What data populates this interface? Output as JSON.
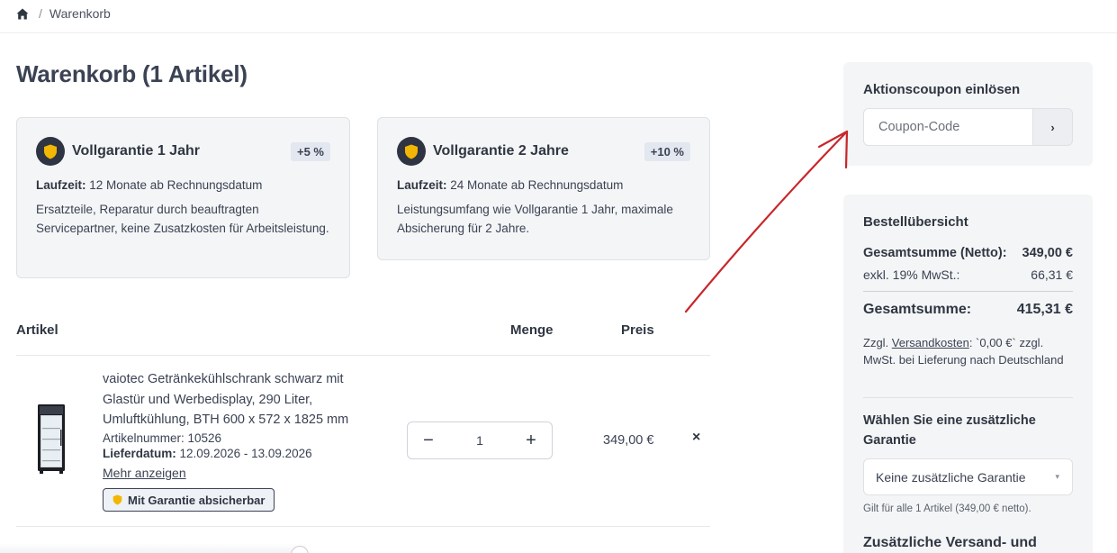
{
  "breadcrumb": {
    "home_icon": "home-icon",
    "separator": "/",
    "current": "Warenkorb"
  },
  "page": {
    "title": "Warenkorb (1 Artikel)"
  },
  "warranty_cards": [
    {
      "title": "Vollgarantie 1 Jahr",
      "badge": "+5 %",
      "runtime_label": "Laufzeit:",
      "runtime_value": "12 Monate ab Rechnungsdatum",
      "description": "Ersatzteile, Reparatur durch beauftragten Servicepartner, keine Zusatzkosten für Arbeitsleistung."
    },
    {
      "title": "Vollgarantie 2 Jahre",
      "badge": "+10 %",
      "runtime_label": "Laufzeit:",
      "runtime_value": "24 Monate ab Rechnungsdatum",
      "description": "Leistungsumfang wie Vollgarantie 1 Jahr, maximale Absicherung für 2 Jahre."
    }
  ],
  "table": {
    "col_article": "Artikel",
    "col_quantity": "Menge",
    "col_price": "Preis"
  },
  "cart_item": {
    "name": "vaiotec Getränkekühlschrank schwarz mit Glastür und Werbedisplay, 290 Liter, Umluftkühlung, BTH 600 x 572 x 1825 mm",
    "article_number": "Artikelnummer: 10526",
    "delivery_label": "Lieferdatum:",
    "delivery_value": "12.09.2026 - 13.09.2026",
    "more_link": "Mehr anzeigen",
    "guarantee_button": "Mit Garantie absicherbar",
    "quantity": "1",
    "minus": "−",
    "plus": "+",
    "price": "349,00 €",
    "remove": "×"
  },
  "coupon": {
    "title": "Aktionscoupon einlösen",
    "placeholder": "Coupon-Code",
    "submit": "›"
  },
  "summary": {
    "title": "Bestellübersicht",
    "netto_label": "Gesamtsumme (Netto):",
    "netto_value": "349,00 €",
    "vat_label": "exkl. 19% MwSt.:",
    "vat_value": "66,31 €",
    "total_label": "Gesamtsumme:",
    "total_value": "415,31 €",
    "shipping_prefix": "Zzgl. ",
    "shipping_link": "Versandkosten",
    "shipping_suffix": ": `0,00 €` zzgl. MwSt. bei Lieferung nach Deutschland",
    "warranty_title": "Wählen Sie eine zusätzliche Garantie",
    "warranty_selected": "Keine zusätzliche Garantie",
    "warranty_note": "Gilt für alle 1 Artikel (349,00 € netto).",
    "shipping_section_title": "Zusätzliche Versand- und"
  },
  "colors": {
    "accent_dark": "#2e3441",
    "shield_yellow": "#f2b705",
    "annotation_red": "#c8262a",
    "card_bg": "#f4f5f6"
  }
}
